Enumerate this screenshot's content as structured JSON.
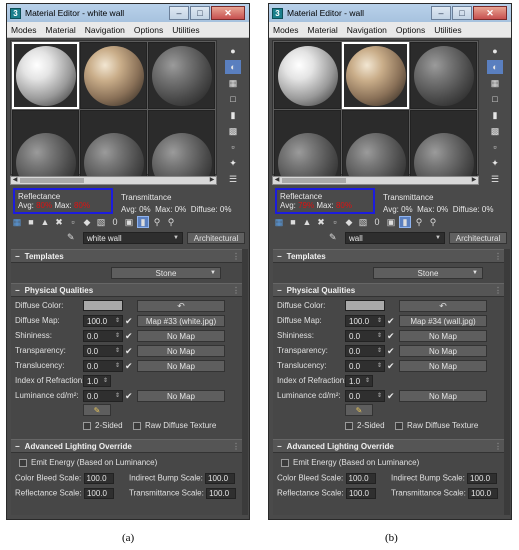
{
  "windows": [
    {
      "title": "Material Editor - white wall",
      "app_icon": "3",
      "menu": [
        "Modes",
        "Material",
        "Navigation",
        "Options",
        "Utilities"
      ],
      "slots": [
        "white",
        "stone",
        "dark",
        "dark",
        "dark",
        "dark"
      ],
      "reflectance": {
        "title": "Reflectance",
        "avg_label": "Avg:",
        "avg": "80%",
        "max_label": "Max:",
        "max": "80%"
      },
      "transmittance": {
        "title": "Transmittance",
        "avg": "Avg:   0%",
        "max": "Max:   0%",
        "diffuse": "Diffuse:   0%"
      },
      "material_name": "white wall",
      "material_type": "Architectural",
      "templates": {
        "header": "Templates",
        "value": "Stone"
      },
      "physical": {
        "header": "Physical Qualities",
        "diffuse_color": "Diffuse Color:",
        "rows": [
          {
            "label": "Diffuse Map:",
            "value": "100.0",
            "map": "Map #33 (white.jpg)"
          },
          {
            "label": "Shininess:",
            "value": "0.0",
            "map": "No Map"
          },
          {
            "label": "Transparency:",
            "value": "0.0",
            "map": "No Map"
          },
          {
            "label": "Translucency:",
            "value": "0.0",
            "map": "No Map"
          }
        ],
        "ior_label": "Index of Refraction:",
        "ior": "1.0",
        "luminance_label": "Luminance cd/m²:",
        "luminance": "0.0",
        "luminance_map": "No Map",
        "two_sided": "2-Sided",
        "raw_diffuse": "Raw Diffuse Texture"
      },
      "advanced": {
        "header": "Advanced Lighting Override",
        "emit": "Emit Energy (Based on Luminance)",
        "color_bleed_label": "Color Bleed Scale:",
        "color_bleed": "100.0",
        "indirect_bump_label": "Indirect Bump Scale:",
        "indirect_bump": "100.0",
        "reflectance_scale_label": "Reflectance Scale:",
        "reflectance_scale": "100.0",
        "transmittance_scale_label": "Transmittance Scale:",
        "transmittance_scale": "100.0"
      },
      "caption": "(a)"
    },
    {
      "title": "Material Editor - wall",
      "app_icon": "3",
      "menu": [
        "Modes",
        "Material",
        "Navigation",
        "Options",
        "Utilities"
      ],
      "slots": [
        "white",
        "stone",
        "dark",
        "dark",
        "dark",
        "dark"
      ],
      "reflectance": {
        "title": "Reflectance",
        "avg_label": "Avg:",
        "avg": "79%",
        "max_label": "Max:",
        "max": "80%"
      },
      "transmittance": {
        "title": "Transmittance",
        "avg": "Avg:   0%",
        "max": "Max:   0%",
        "diffuse": "Diffuse:   0%"
      },
      "material_name": "wall",
      "material_type": "Architectural",
      "templates": {
        "header": "Templates",
        "value": "Stone"
      },
      "physical": {
        "header": "Physical Qualities",
        "diffuse_color": "Diffuse Color:",
        "rows": [
          {
            "label": "Diffuse Map:",
            "value": "100.0",
            "map": "Map #34 (wall.jpg)"
          },
          {
            "label": "Shininess:",
            "value": "0.0",
            "map": "No Map"
          },
          {
            "label": "Transparency:",
            "value": "0.0",
            "map": "No Map"
          },
          {
            "label": "Translucency:",
            "value": "0.0",
            "map": "No Map"
          }
        ],
        "ior_label": "Index of Refraction:",
        "ior": "1.0",
        "luminance_label": "Luminance cd/m²:",
        "luminance": "0.0",
        "luminance_map": "No Map",
        "two_sided": "2-Sided",
        "raw_diffuse": "Raw Diffuse Texture"
      },
      "advanced": {
        "header": "Advanced Lighting Override",
        "emit": "Emit Energy (Based on Luminance)",
        "color_bleed_label": "Color Bleed Scale:",
        "color_bleed": "100.0",
        "indirect_bump_label": "Indirect Bump Scale:",
        "indirect_bump": "100.0",
        "reflectance_scale_label": "Reflectance Scale:",
        "reflectance_scale": "100.0",
        "transmittance_scale_label": "Transmittance Scale:",
        "transmittance_scale": "100.0"
      },
      "caption": "(b)"
    }
  ],
  "colors": {
    "highlight_box": "#1c1cde",
    "warning_text": "#e01010",
    "panel_bg": "#474747"
  }
}
